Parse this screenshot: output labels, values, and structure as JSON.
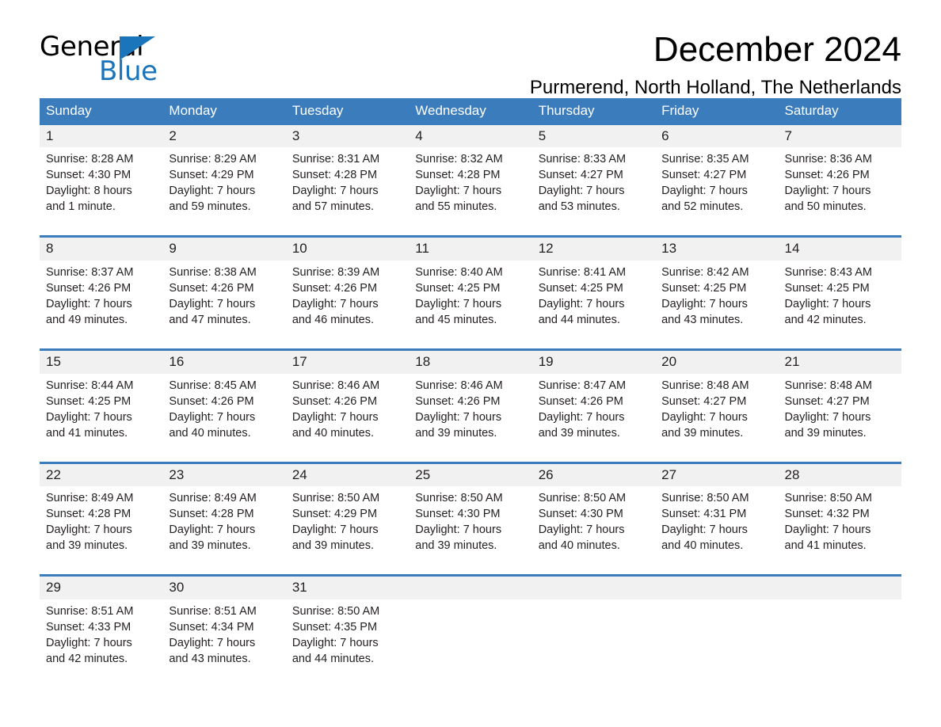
{
  "brand": {
    "name_dark": "General",
    "name_light": "Blue",
    "triangle_color": "#1b75bb"
  },
  "header": {
    "month_title": "December 2024",
    "location": "Purmerend, North Holland, The Netherlands"
  },
  "colors": {
    "header_blue": "#3b7cbd",
    "daynum_band": "#f1f1f1",
    "text": "#231f20",
    "brand_blue": "#1b75bb"
  },
  "weekdays": [
    "Sunday",
    "Monday",
    "Tuesday",
    "Wednesday",
    "Thursday",
    "Friday",
    "Saturday"
  ],
  "weeks": [
    [
      {
        "day": "1",
        "sunrise": "Sunrise: 8:28 AM",
        "sunset": "Sunset: 4:30 PM",
        "daylight1": "Daylight: 8 hours",
        "daylight2": "and 1 minute."
      },
      {
        "day": "2",
        "sunrise": "Sunrise: 8:29 AM",
        "sunset": "Sunset: 4:29 PM",
        "daylight1": "Daylight: 7 hours",
        "daylight2": "and 59 minutes."
      },
      {
        "day": "3",
        "sunrise": "Sunrise: 8:31 AM",
        "sunset": "Sunset: 4:28 PM",
        "daylight1": "Daylight: 7 hours",
        "daylight2": "and 57 minutes."
      },
      {
        "day": "4",
        "sunrise": "Sunrise: 8:32 AM",
        "sunset": "Sunset: 4:28 PM",
        "daylight1": "Daylight: 7 hours",
        "daylight2": "and 55 minutes."
      },
      {
        "day": "5",
        "sunrise": "Sunrise: 8:33 AM",
        "sunset": "Sunset: 4:27 PM",
        "daylight1": "Daylight: 7 hours",
        "daylight2": "and 53 minutes."
      },
      {
        "day": "6",
        "sunrise": "Sunrise: 8:35 AM",
        "sunset": "Sunset: 4:27 PM",
        "daylight1": "Daylight: 7 hours",
        "daylight2": "and 52 minutes."
      },
      {
        "day": "7",
        "sunrise": "Sunrise: 8:36 AM",
        "sunset": "Sunset: 4:26 PM",
        "daylight1": "Daylight: 7 hours",
        "daylight2": "and 50 minutes."
      }
    ],
    [
      {
        "day": "8",
        "sunrise": "Sunrise: 8:37 AM",
        "sunset": "Sunset: 4:26 PM",
        "daylight1": "Daylight: 7 hours",
        "daylight2": "and 49 minutes."
      },
      {
        "day": "9",
        "sunrise": "Sunrise: 8:38 AM",
        "sunset": "Sunset: 4:26 PM",
        "daylight1": "Daylight: 7 hours",
        "daylight2": "and 47 minutes."
      },
      {
        "day": "10",
        "sunrise": "Sunrise: 8:39 AM",
        "sunset": "Sunset: 4:26 PM",
        "daylight1": "Daylight: 7 hours",
        "daylight2": "and 46 minutes."
      },
      {
        "day": "11",
        "sunrise": "Sunrise: 8:40 AM",
        "sunset": "Sunset: 4:25 PM",
        "daylight1": "Daylight: 7 hours",
        "daylight2": "and 45 minutes."
      },
      {
        "day": "12",
        "sunrise": "Sunrise: 8:41 AM",
        "sunset": "Sunset: 4:25 PM",
        "daylight1": "Daylight: 7 hours",
        "daylight2": "and 44 minutes."
      },
      {
        "day": "13",
        "sunrise": "Sunrise: 8:42 AM",
        "sunset": "Sunset: 4:25 PM",
        "daylight1": "Daylight: 7 hours",
        "daylight2": "and 43 minutes."
      },
      {
        "day": "14",
        "sunrise": "Sunrise: 8:43 AM",
        "sunset": "Sunset: 4:25 PM",
        "daylight1": "Daylight: 7 hours",
        "daylight2": "and 42 minutes."
      }
    ],
    [
      {
        "day": "15",
        "sunrise": "Sunrise: 8:44 AM",
        "sunset": "Sunset: 4:25 PM",
        "daylight1": "Daylight: 7 hours",
        "daylight2": "and 41 minutes."
      },
      {
        "day": "16",
        "sunrise": "Sunrise: 8:45 AM",
        "sunset": "Sunset: 4:26 PM",
        "daylight1": "Daylight: 7 hours",
        "daylight2": "and 40 minutes."
      },
      {
        "day": "17",
        "sunrise": "Sunrise: 8:46 AM",
        "sunset": "Sunset: 4:26 PM",
        "daylight1": "Daylight: 7 hours",
        "daylight2": "and 40 minutes."
      },
      {
        "day": "18",
        "sunrise": "Sunrise: 8:46 AM",
        "sunset": "Sunset: 4:26 PM",
        "daylight1": "Daylight: 7 hours",
        "daylight2": "and 39 minutes."
      },
      {
        "day": "19",
        "sunrise": "Sunrise: 8:47 AM",
        "sunset": "Sunset: 4:26 PM",
        "daylight1": "Daylight: 7 hours",
        "daylight2": "and 39 minutes."
      },
      {
        "day": "20",
        "sunrise": "Sunrise: 8:48 AM",
        "sunset": "Sunset: 4:27 PM",
        "daylight1": "Daylight: 7 hours",
        "daylight2": "and 39 minutes."
      },
      {
        "day": "21",
        "sunrise": "Sunrise: 8:48 AM",
        "sunset": "Sunset: 4:27 PM",
        "daylight1": "Daylight: 7 hours",
        "daylight2": "and 39 minutes."
      }
    ],
    [
      {
        "day": "22",
        "sunrise": "Sunrise: 8:49 AM",
        "sunset": "Sunset: 4:28 PM",
        "daylight1": "Daylight: 7 hours",
        "daylight2": "and 39 minutes."
      },
      {
        "day": "23",
        "sunrise": "Sunrise: 8:49 AM",
        "sunset": "Sunset: 4:28 PM",
        "daylight1": "Daylight: 7 hours",
        "daylight2": "and 39 minutes."
      },
      {
        "day": "24",
        "sunrise": "Sunrise: 8:50 AM",
        "sunset": "Sunset: 4:29 PM",
        "daylight1": "Daylight: 7 hours",
        "daylight2": "and 39 minutes."
      },
      {
        "day": "25",
        "sunrise": "Sunrise: 8:50 AM",
        "sunset": "Sunset: 4:30 PM",
        "daylight1": "Daylight: 7 hours",
        "daylight2": "and 39 minutes."
      },
      {
        "day": "26",
        "sunrise": "Sunrise: 8:50 AM",
        "sunset": "Sunset: 4:30 PM",
        "daylight1": "Daylight: 7 hours",
        "daylight2": "and 40 minutes."
      },
      {
        "day": "27",
        "sunrise": "Sunrise: 8:50 AM",
        "sunset": "Sunset: 4:31 PM",
        "daylight1": "Daylight: 7 hours",
        "daylight2": "and 40 minutes."
      },
      {
        "day": "28",
        "sunrise": "Sunrise: 8:50 AM",
        "sunset": "Sunset: 4:32 PM",
        "daylight1": "Daylight: 7 hours",
        "daylight2": "and 41 minutes."
      }
    ],
    [
      {
        "day": "29",
        "sunrise": "Sunrise: 8:51 AM",
        "sunset": "Sunset: 4:33 PM",
        "daylight1": "Daylight: 7 hours",
        "daylight2": "and 42 minutes."
      },
      {
        "day": "30",
        "sunrise": "Sunrise: 8:51 AM",
        "sunset": "Sunset: 4:34 PM",
        "daylight1": "Daylight: 7 hours",
        "daylight2": "and 43 minutes."
      },
      {
        "day": "31",
        "sunrise": "Sunrise: 8:50 AM",
        "sunset": "Sunset: 4:35 PM",
        "daylight1": "Daylight: 7 hours",
        "daylight2": "and 44 minutes."
      },
      {
        "day": "",
        "sunrise": "",
        "sunset": "",
        "daylight1": "",
        "daylight2": ""
      },
      {
        "day": "",
        "sunrise": "",
        "sunset": "",
        "daylight1": "",
        "daylight2": ""
      },
      {
        "day": "",
        "sunrise": "",
        "sunset": "",
        "daylight1": "",
        "daylight2": ""
      },
      {
        "day": "",
        "sunrise": "",
        "sunset": "",
        "daylight1": "",
        "daylight2": ""
      }
    ]
  ]
}
